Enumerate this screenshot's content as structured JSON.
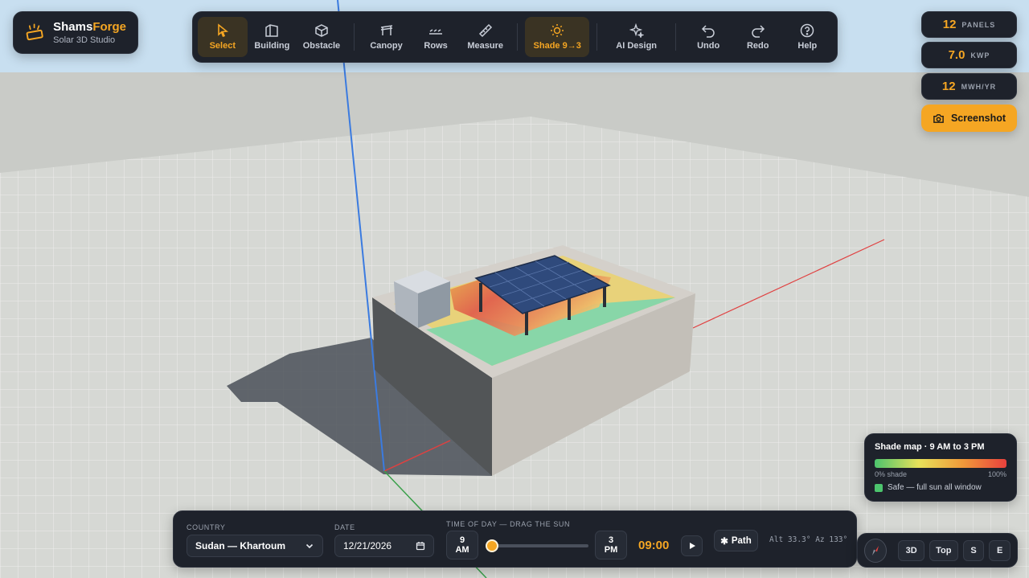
{
  "brand": {
    "name_part1": "Shams",
    "name_part2": "Forge",
    "subtitle": "Solar 3D Studio"
  },
  "toolbar": {
    "tools": [
      {
        "label": "Select",
        "icon": "cursor-icon",
        "active": true
      },
      {
        "label": "Building",
        "icon": "building-icon"
      },
      {
        "label": "Obstacle",
        "icon": "cube-icon"
      },
      {
        "label": "Canopy",
        "icon": "canopy-icon"
      },
      {
        "label": "Rows",
        "icon": "rows-icon"
      },
      {
        "label": "Measure",
        "icon": "ruler-icon"
      },
      {
        "label": "Shade 9→3",
        "icon": "sun-icon",
        "active": true
      },
      {
        "label": "AI Design",
        "icon": "sparkles-icon"
      },
      {
        "label": "Undo",
        "icon": "undo-icon"
      },
      {
        "label": "Redo",
        "icon": "redo-icon"
      },
      {
        "label": "Help",
        "icon": "help-icon"
      }
    ]
  },
  "stats": {
    "panels": {
      "value": "12",
      "unit": "PANELS"
    },
    "power": {
      "value": "7.0",
      "unit": "KWP"
    },
    "energy": {
      "value": "12",
      "unit": "MWH/YR"
    }
  },
  "screenshot_label": "Screenshot",
  "legend": {
    "title": "Shade map · 9 AM to 3 PM",
    "min_label": "0% shade",
    "max_label": "100%",
    "safe_label": "Safe — full sun all window",
    "colors": [
      "#4cc46d",
      "#e8e25a",
      "#f09a3a",
      "#e8413d"
    ]
  },
  "controls": {
    "country_label": "COUNTRY",
    "country_value": "Sudan — Khartoum",
    "date_label": "DATE",
    "date_value": "12/21/2026",
    "time_label": "TIME OF DAY — DRAG THE SUN",
    "start_hour": "9",
    "start_ampm": "AM",
    "end_hour": "3",
    "end_ampm": "PM",
    "slider_fraction": 0.0,
    "current_time": "09:00",
    "path_label": "Path",
    "alt_az": "Alt 33.3° Az 133°"
  },
  "view": {
    "buttons": [
      "3D",
      "Top",
      "S",
      "E"
    ]
  },
  "colors": {
    "accent": "#f5a623",
    "panel_bg": "#1e222b",
    "sky": "#c8dff0",
    "ground": "#c9cbc7"
  }
}
